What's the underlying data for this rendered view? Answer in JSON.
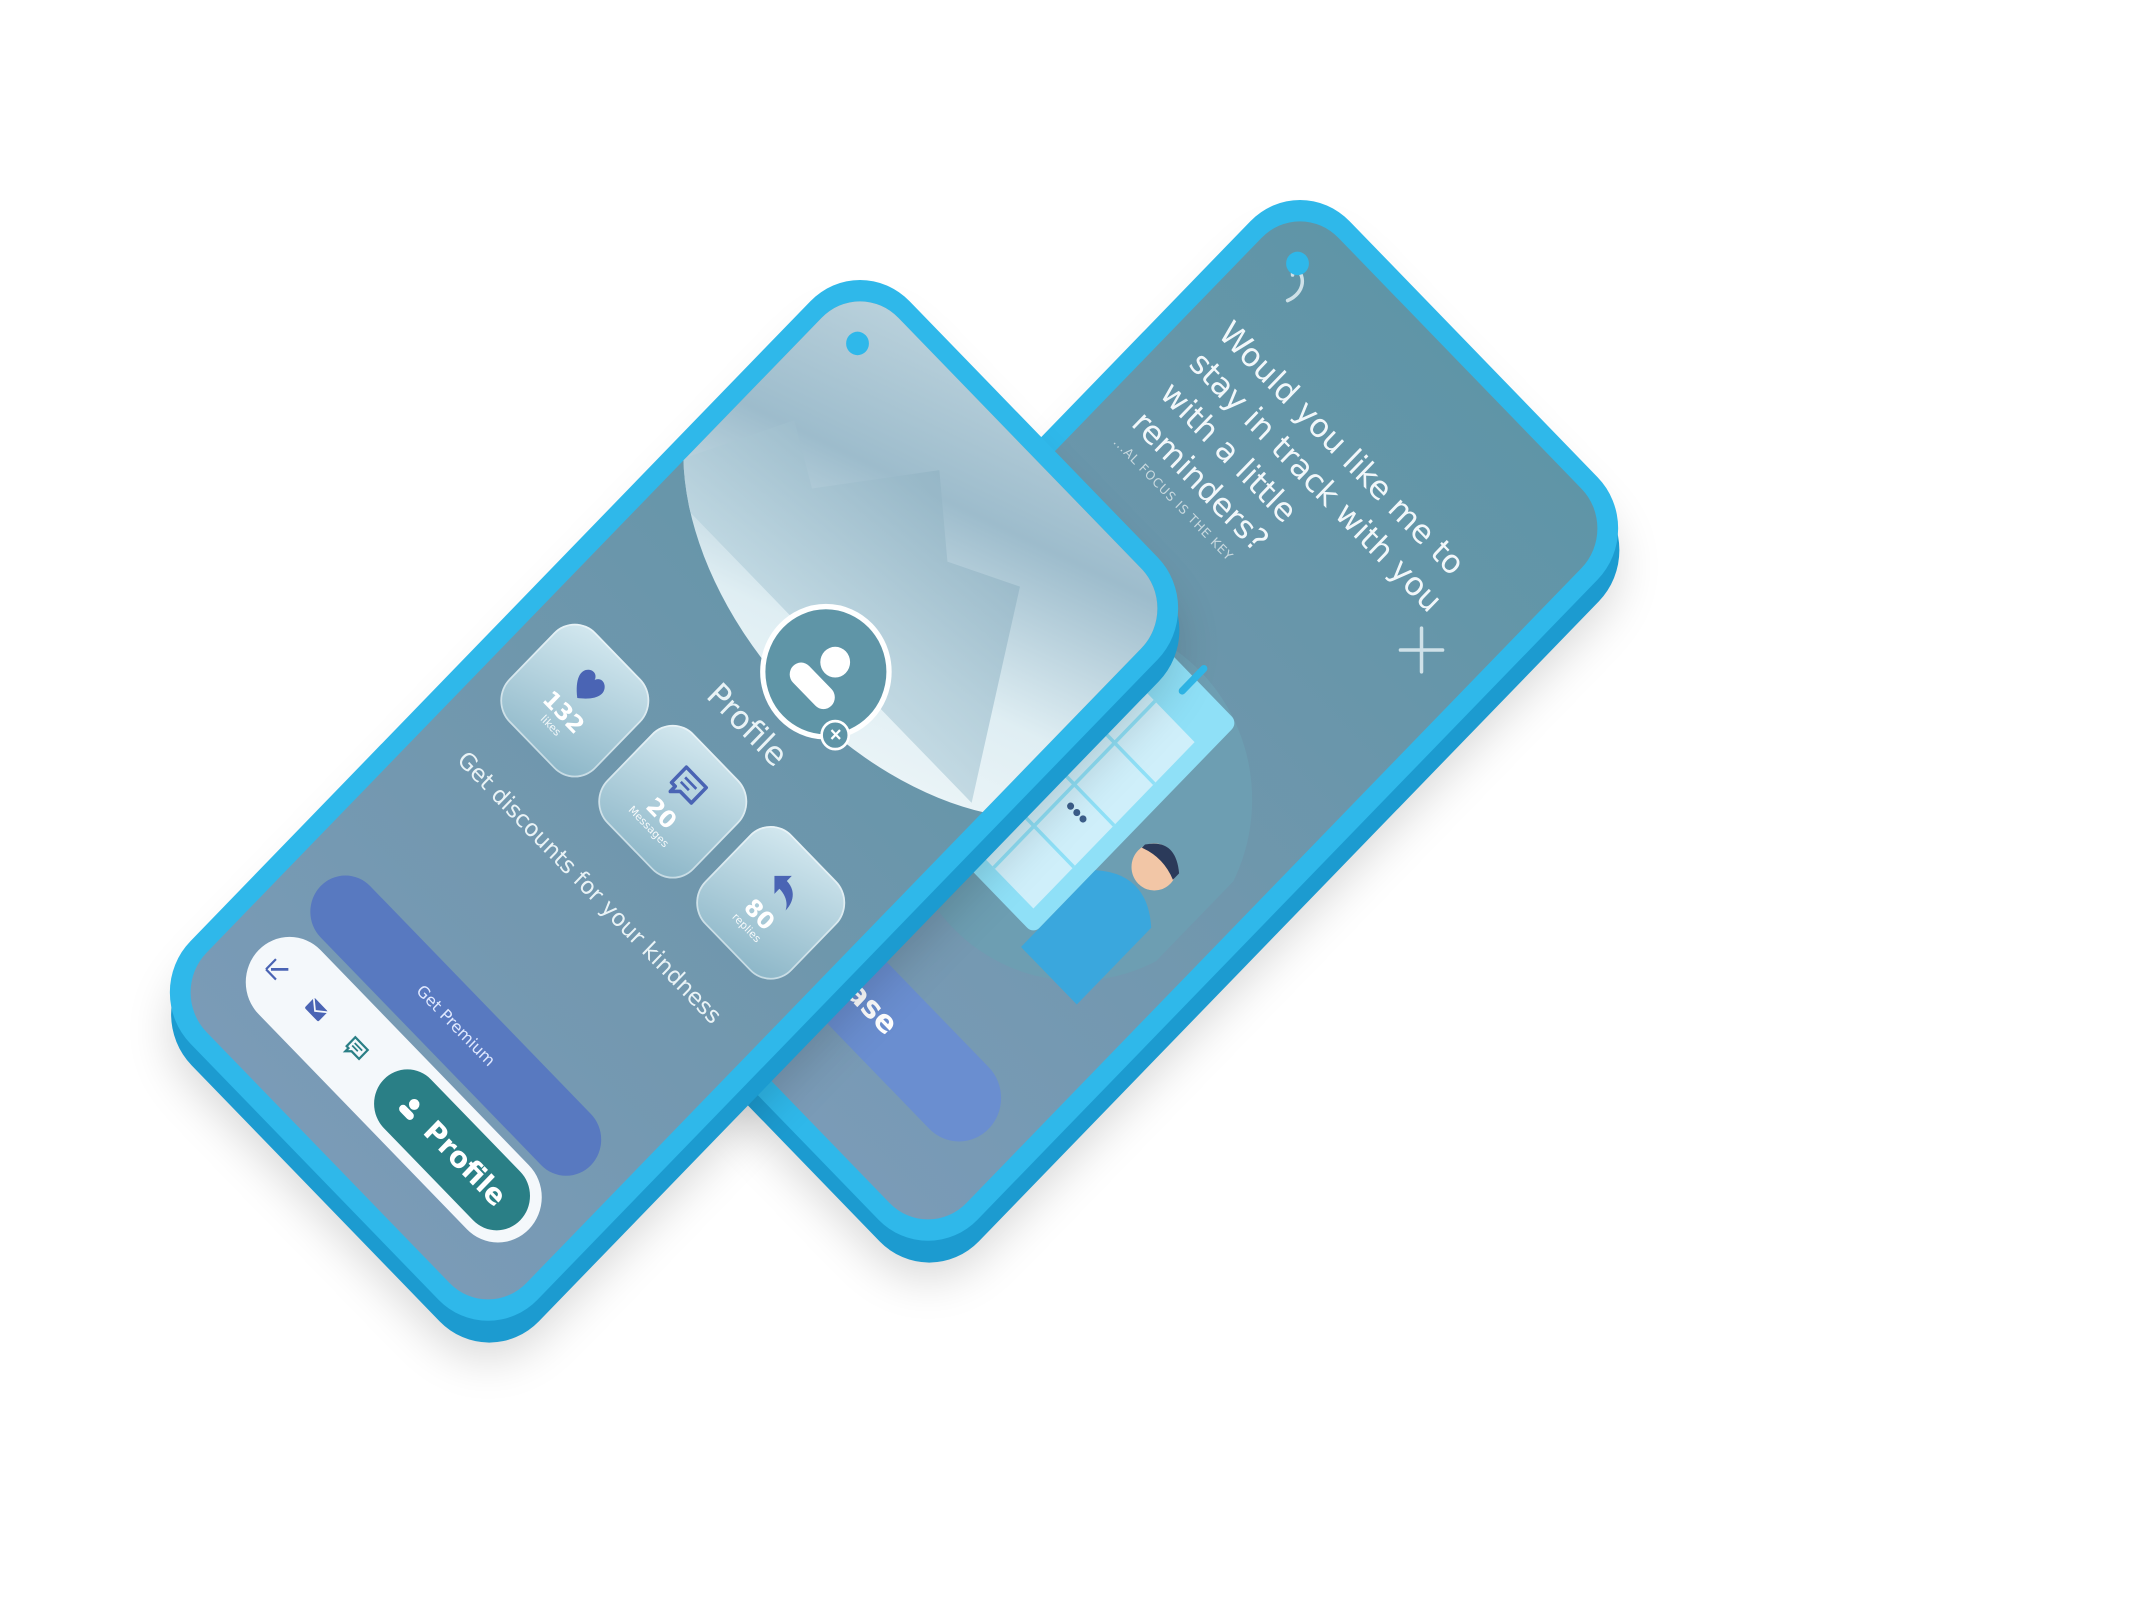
{
  "profile_screen": {
    "title": "Profile",
    "stats": [
      {
        "icon": "heart-icon",
        "value": "132",
        "label": "likes"
      },
      {
        "icon": "message-icon",
        "value": "20",
        "label": "Messages"
      },
      {
        "icon": "reply-icon",
        "value": "80",
        "label": "replies"
      }
    ],
    "tagline": "Get discounts for your kindness",
    "premium_button": "Get Premium",
    "nav": {
      "items": [
        "edit-icon",
        "mail-icon",
        "chat-icon"
      ],
      "active_label": "Profile"
    }
  },
  "reminder_screen": {
    "question": "Would you like me to stay in track with you with a little reminders?",
    "hint": "...AL FOCUS IS THE KEY",
    "confirm_button": "Please"
  },
  "colors": {
    "shell": "#2fb8ea",
    "screen": "#5f95a7",
    "accent_blue": "#5879c0",
    "active_nav": "#2a7f86"
  }
}
